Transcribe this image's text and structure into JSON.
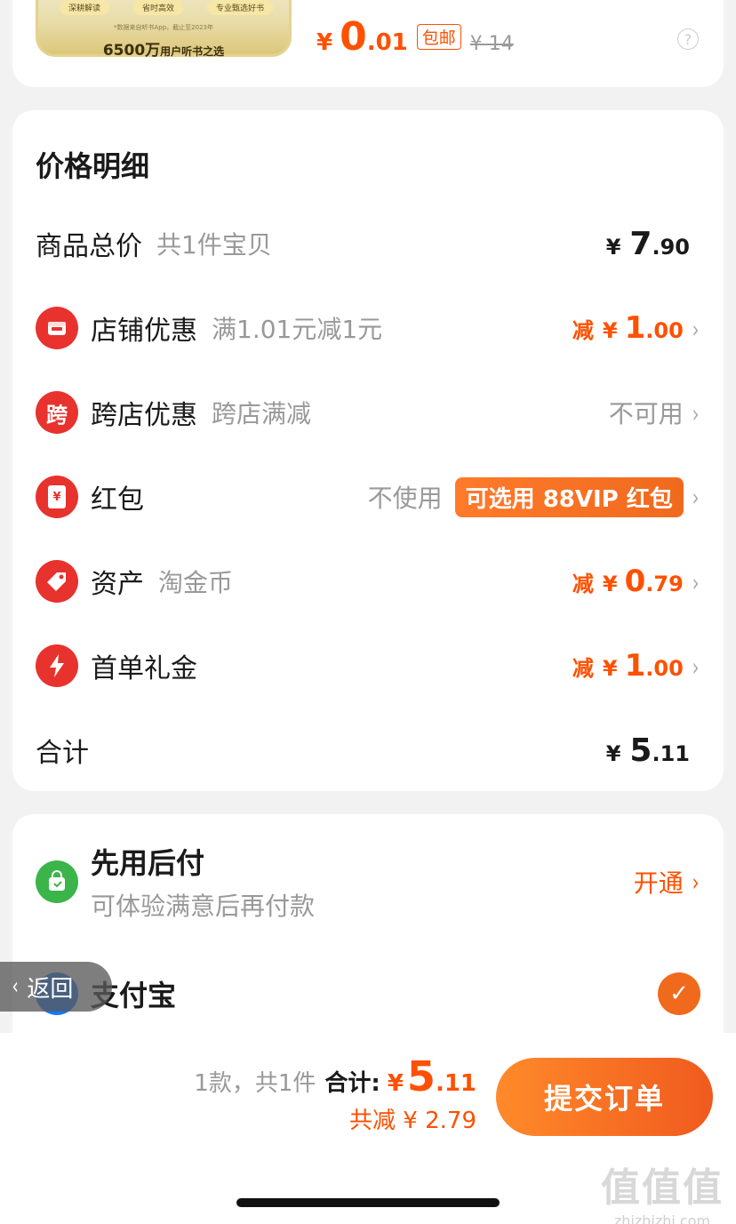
{
  "product": {
    "tags": [
      "深耕解读",
      "省时高效",
      "专业甄选好书"
    ],
    "note": "*数据来自听书App，截止至2023年",
    "slogan_num": "6500万",
    "slogan_text": "用户听书之选",
    "price_symbol": "¥",
    "price_int": "0",
    "price_dec": ".01",
    "free_shipping": "包邮",
    "original_price": "¥ 14",
    "help": "?"
  },
  "price_detail": {
    "title": "价格明细",
    "goods_total_label": "商品总价",
    "goods_total_sub": "共1件宝贝",
    "goods_total_sym": "¥",
    "goods_total_int": "7",
    "goods_total_dec": ".90",
    "shop_label": "店铺优惠",
    "shop_sub": "满1.01元减1元",
    "shop_d_lbl": "减",
    "shop_d_sym": "¥",
    "shop_d_int": "1",
    "shop_d_dec": ".00",
    "cross_label": "跨店优惠",
    "cross_sub": "跨店满减",
    "cross_status": "不可用",
    "cross_icon": "跨",
    "redpack_label": "红包",
    "redpack_icon": "¥",
    "redpack_status": "不使用",
    "redpack_vip": "可选用 88VIP 红包",
    "asset_label": "资产",
    "asset_sub": "淘金币",
    "asset_d_lbl": "减",
    "asset_d_sym": "¥",
    "asset_d_int": "0",
    "asset_d_dec": ".79",
    "first_label": "首单礼金",
    "first_d_lbl": "减",
    "first_d_sym": "¥",
    "first_d_int": "1",
    "first_d_dec": ".00",
    "total_label": "合计",
    "total_sym": "¥",
    "total_int": "5",
    "total_dec": ".11",
    "chevron": "›"
  },
  "payment": {
    "bnpl_title": "先用后付",
    "bnpl_sub": "可体验满意后再付款",
    "bnpl_action": "开通",
    "alipay_label": "支付宝",
    "check": "✓"
  },
  "back": {
    "label": "返回",
    "arrow": "‹"
  },
  "bottom": {
    "count": "1款，共1件",
    "total_label": "合计:",
    "sym": "¥",
    "int": "5",
    "dec": ".11",
    "saved": "共减 ¥ 2.79",
    "submit": "提交订单"
  },
  "watermark": {
    "big": "值值值",
    "small": "zhizhizhi.com"
  },
  "colors": {
    "accent": "#ff5000",
    "red_icon": "#e8322d",
    "green_icon": "#3bb54a",
    "alipay_blue": "#1677ff"
  }
}
